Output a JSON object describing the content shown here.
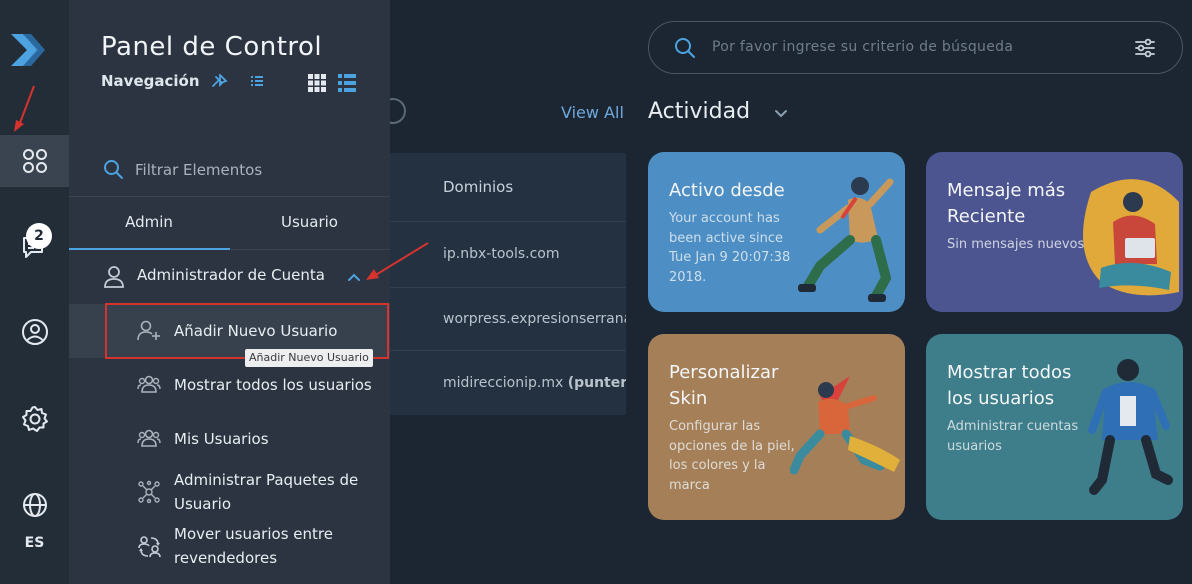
{
  "panel": {
    "title": "Panel de Control",
    "nav_label": "Navegación",
    "filter_placeholder": "Filtrar Elementos",
    "tabs": [
      {
        "label": "Admin",
        "active": true
      },
      {
        "label": "Usuario",
        "active": false
      }
    ],
    "group": {
      "label": "Administrador de Cuenta"
    },
    "items": [
      {
        "label": "Añadir Nuevo Usuario",
        "icon": "add-user-icon"
      },
      {
        "label": "Mostrar todos los usuarios",
        "icon": "users-icon"
      },
      {
        "label": "Mis Usuarios",
        "icon": "users-icon"
      },
      {
        "label": "Administrar Paquetes de Usuario",
        "icon": "package-icon"
      },
      {
        "label": "Mover usuarios entre revendedores",
        "icon": "move-users-icon"
      }
    ],
    "tooltip": "Añadir Nuevo Usuario"
  },
  "rail": {
    "badge": "2",
    "language": "ES"
  },
  "background": {
    "view_all": "View All",
    "table_header": "Dominios",
    "rows": [
      {
        "domain": "ip.nbx-tools.com"
      },
      {
        "domain": "worpress.expresionserrana"
      },
      {
        "domain_prefix": "midireccionip.mx ",
        "domain_bold": "(puntero"
      }
    ]
  },
  "search": {
    "placeholder": "Por favor ingrese su criterio de búsqueda"
  },
  "activity": {
    "title": "Actividad",
    "cards": [
      {
        "title": "Activo desde",
        "text": "Your account has been active since Tue Jan 9 20:07:38 2018."
      },
      {
        "title": "Mensaje más Reciente",
        "text": "Sin mensajes nuevos"
      },
      {
        "title": "Personalizar Skin",
        "text": "Configurar las opciones de la piel, los colores y la marca"
      },
      {
        "title": "Mostrar todos los usuarios",
        "text": "Administrar cuentas usuarios"
      }
    ]
  },
  "colors": {
    "accent": "#4da3e0",
    "card_blue": "#4d8fc4",
    "card_purple": "#4c5590",
    "card_tan": "#a47f58",
    "card_teal": "#3e7d8a",
    "highlight_red": "#d6332e"
  }
}
